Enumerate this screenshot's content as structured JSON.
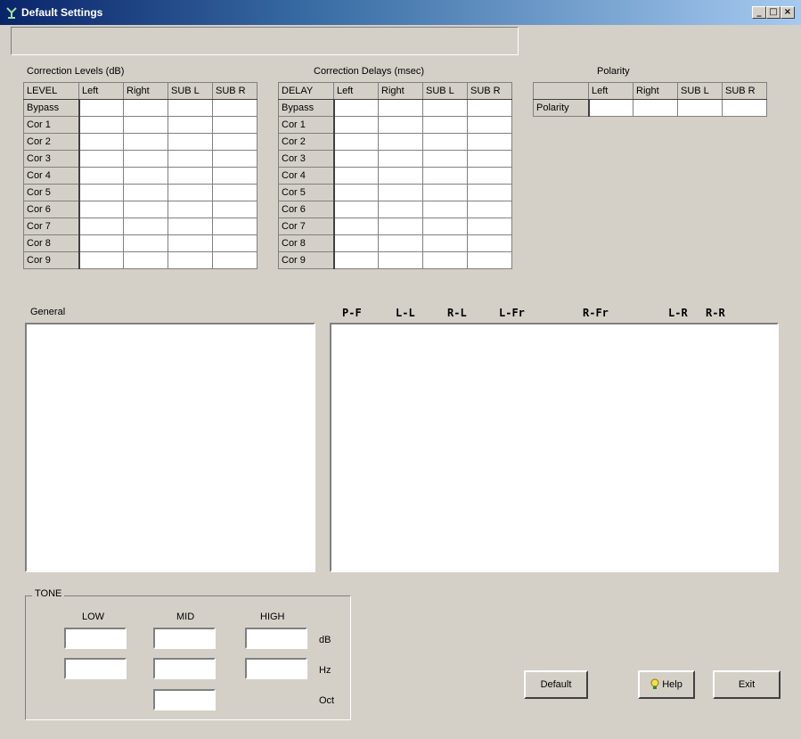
{
  "window": {
    "title": "Default Settings",
    "controls": {
      "minimize": "_",
      "maximize": "□",
      "close": "×"
    }
  },
  "levels": {
    "caption": "Correction Levels (dB)",
    "corner": "LEVEL",
    "columns": [
      "Left",
      "Right",
      "SUB L",
      "SUB R"
    ],
    "rows": [
      "Bypass",
      "Cor 1",
      "Cor 2",
      "Cor 3",
      "Cor 4",
      "Cor 5",
      "Cor 6",
      "Cor 7",
      "Cor 8",
      "Cor 9"
    ]
  },
  "delays": {
    "caption": "Correction Delays (msec)",
    "corner": "DELAY",
    "columns": [
      "Left",
      "Right",
      "SUB L",
      "SUB R"
    ],
    "rows": [
      "Bypass",
      "Cor 1",
      "Cor 2",
      "Cor 3",
      "Cor 4",
      "Cor 5",
      "Cor 6",
      "Cor 7",
      "Cor 8",
      "Cor 9"
    ]
  },
  "polarity": {
    "caption": "Polarity",
    "corner": "",
    "columns": [
      "Left",
      "Right",
      "SUB L",
      "SUB R"
    ],
    "rows": [
      "Polarity"
    ]
  },
  "general": {
    "label": "General"
  },
  "channel_labels": [
    "P-F",
    "L-L",
    "R-L",
    "L-Fr",
    "R-Fr",
    "L-R",
    "R-R"
  ],
  "tone": {
    "legend": "TONE",
    "columns": [
      "LOW",
      "MID",
      "HIGH"
    ],
    "units": [
      "dB",
      "Hz",
      "Oct"
    ]
  },
  "buttons": {
    "default": "Default",
    "help": "Help",
    "exit": "Exit"
  }
}
